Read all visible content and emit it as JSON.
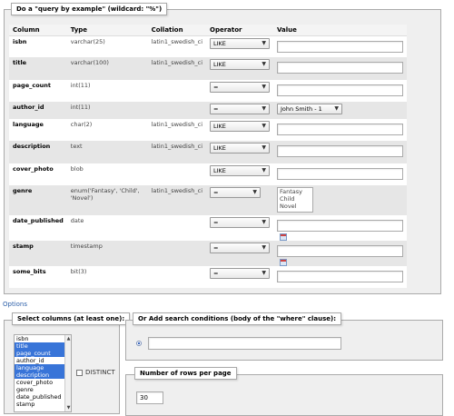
{
  "qbe_legend": "Do a \"query by example\" (wildcard: \"%\")",
  "columns_header": {
    "column": "Column",
    "type": "Type",
    "collation": "Collation",
    "operator": "Operator",
    "value": "Value"
  },
  "rows": [
    {
      "name": "isbn",
      "type": "varchar(25)",
      "collation": "latin1_swedish_ci",
      "operator": "LIKE",
      "value": ""
    },
    {
      "name": "title",
      "type": "varchar(100)",
      "collation": "latin1_swedish_ci",
      "operator": "LIKE",
      "value": ""
    },
    {
      "name": "page_count",
      "type": "int(11)",
      "collation": "",
      "operator": "=",
      "value": ""
    },
    {
      "name": "author_id",
      "type": "int(11)",
      "collation": "",
      "operator": "=",
      "value": "John Smith - 1"
    },
    {
      "name": "language",
      "type": "char(2)",
      "collation": "latin1_swedish_ci",
      "operator": "LIKE",
      "value": ""
    },
    {
      "name": "description",
      "type": "text",
      "collation": "latin1_swedish_ci",
      "operator": "LIKE",
      "value": ""
    },
    {
      "name": "cover_photo",
      "type": "blob",
      "collation": "",
      "operator": "LIKE",
      "value": ""
    },
    {
      "name": "genre",
      "type": "enum('Fantasy', 'Child', 'Novel')",
      "collation": "latin1_swedish_ci",
      "operator": "=",
      "value": ""
    },
    {
      "name": "date_published",
      "type": "date",
      "collation": "",
      "operator": "=",
      "value": ""
    },
    {
      "name": "stamp",
      "type": "timestamp",
      "collation": "",
      "operator": "=",
      "value": ""
    },
    {
      "name": "some_bits",
      "type": "bit(3)",
      "collation": "",
      "operator": "=",
      "value": ""
    }
  ],
  "genre_options": [
    "Fantasy",
    "Child",
    "Novel"
  ],
  "options_link": "Options",
  "select_columns_legend": "Select columns (at least one):",
  "column_list": [
    {
      "name": "isbn",
      "selected": false
    },
    {
      "name": "title",
      "selected": true
    },
    {
      "name": "page_count",
      "selected": true
    },
    {
      "name": "author_id",
      "selected": false
    },
    {
      "name": "language",
      "selected": true
    },
    {
      "name": "description",
      "selected": true
    },
    {
      "name": "cover_photo",
      "selected": false
    },
    {
      "name": "genre",
      "selected": false
    },
    {
      "name": "date_published",
      "selected": false
    },
    {
      "name": "stamp",
      "selected": false
    }
  ],
  "distinct_label": "DISTINCT",
  "where_legend": "Or Add search conditions (body of the \"where\" clause):",
  "rows_per_page_legend": "Number of rows per page",
  "rows_per_page_value": "30"
}
